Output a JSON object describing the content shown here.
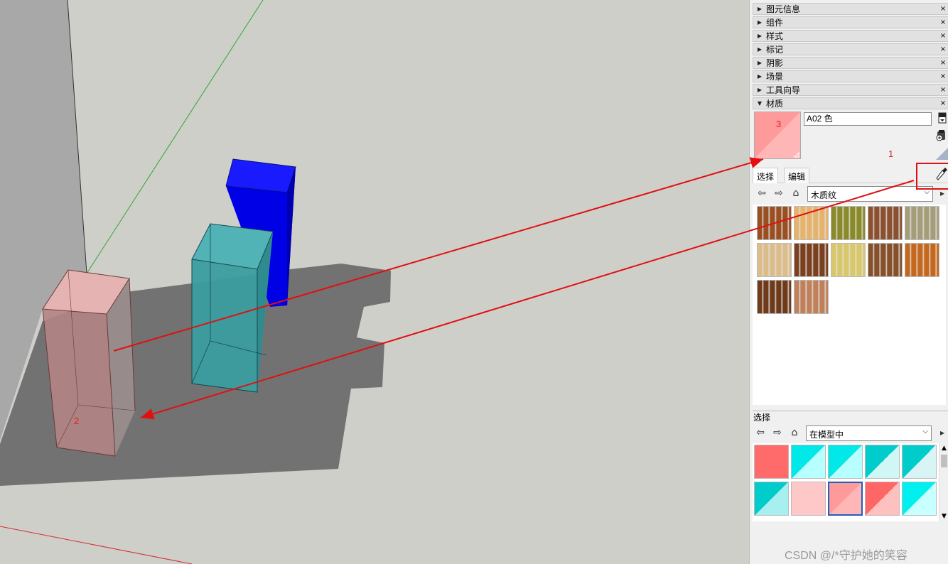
{
  "tray": {
    "rows": [
      {
        "label": "图元信息",
        "expanded": false
      },
      {
        "label": "组件",
        "expanded": false
      },
      {
        "label": "样式",
        "expanded": false
      },
      {
        "label": "标记",
        "expanded": false
      },
      {
        "label": "阴影",
        "expanded": false
      },
      {
        "label": "场景",
        "expanded": false
      },
      {
        "label": "工具向导",
        "expanded": false
      },
      {
        "label": "材质",
        "expanded": true
      }
    ],
    "close_glyph": "×",
    "collapsed_glyph": "▶",
    "expanded_glyph": "▼"
  },
  "materials": {
    "current_name": "A02 色",
    "tabs": [
      "选择",
      "编辑"
    ],
    "library_select": "木质纹",
    "wood_swatches": [
      "#9a4f22",
      "#e6b36a",
      "#8a8a2a",
      "#8a5030",
      "#a59c7a",
      "#dcbd8a",
      "#7a4020",
      "#d9c86a",
      "#86502a",
      "#c5671c",
      "#6e3a1a",
      "#c0805a"
    ],
    "select_panel_title": "选择",
    "model_select": "在模型中",
    "model_swatches": [
      {
        "a": "#ff6b6b",
        "b": "#ff6b6b"
      },
      {
        "a": "#00e8e8",
        "b": "#b8ffff"
      },
      {
        "a": "#00e8e8",
        "b": "#b8ffff"
      },
      {
        "a": "#00cccc",
        "b": "#d0f6f6"
      },
      {
        "a": "#00cccc",
        "b": "#d8f4f4"
      },
      {
        "a": "#00cccc",
        "b": "#a8f0f0"
      },
      {
        "a": "#ffc8c8",
        "b": "#ffc8c8"
      },
      {
        "a": "#ff9a9a",
        "b": "#ffb6b6",
        "selected": true
      },
      {
        "a": "#ff6666",
        "b": "#ffc0c0"
      },
      {
        "a": "#00f0f0",
        "b": "#c8ffff"
      }
    ]
  },
  "annotations": {
    "label_1": "1",
    "label_2": "2",
    "label_3": "3"
  },
  "icons": {
    "home": "home-icon",
    "back": "back-arrow-icon",
    "forward": "forward-arrow-icon",
    "eyedropper": "eyedropper-icon",
    "create_material": "create-material-icon",
    "paint_bucket": "paint-bucket-icon"
  },
  "watermark": "CSDN @/*守护她的笑容"
}
